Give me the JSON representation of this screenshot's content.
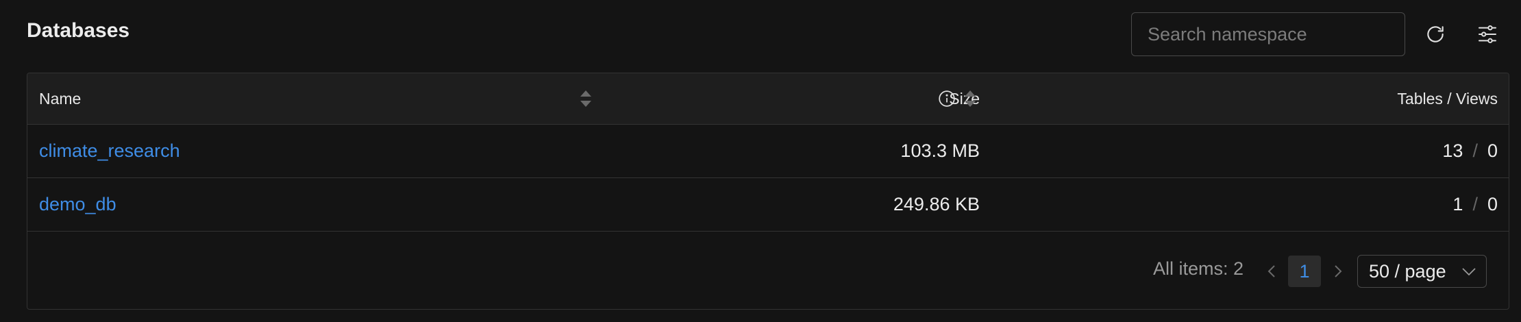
{
  "header": {
    "title": "Databases",
    "search_placeholder": "Search namespace",
    "refresh_icon": "refresh-icon",
    "settings_icon": "sliders-icon"
  },
  "table": {
    "columns": {
      "name": "Name",
      "size": "Size",
      "tables_views": "Tables / Views"
    },
    "rows": [
      {
        "name": "climate_research",
        "size": "103.3 MB",
        "tables": "13",
        "views": "0"
      },
      {
        "name": "demo_db",
        "size": "249.86 KB",
        "tables": "1",
        "views": "0"
      }
    ],
    "separator": "/"
  },
  "pagination": {
    "total_label": "All items: 2",
    "current_page": "1",
    "page_size": "50 / page"
  },
  "colors": {
    "background": "#141414",
    "header_bg": "#1e1e1e",
    "link": "#3f8de6",
    "border": "#333333"
  }
}
